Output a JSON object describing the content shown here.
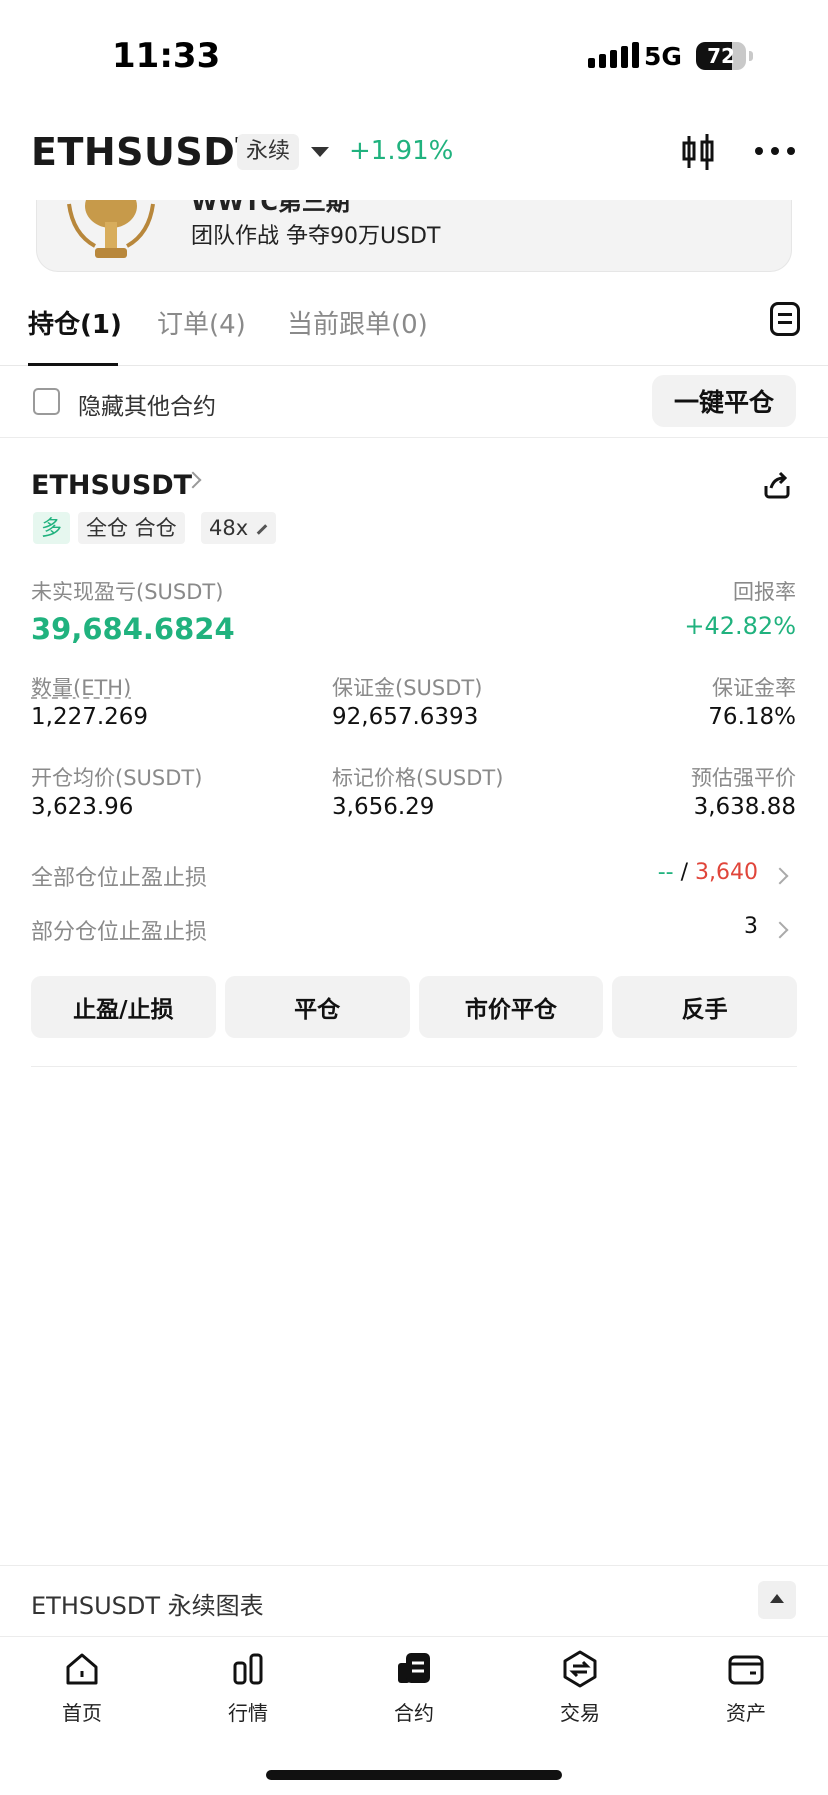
{
  "status_bar": {
    "time": "11:33",
    "network": "5G",
    "battery": "72",
    "battery_level": 0.72
  },
  "header": {
    "symbol": "ETHSUSDT",
    "contract_type": "永续",
    "change": "+1.91%"
  },
  "banner": {
    "title_partial": "WWTC第三期",
    "text": "团队作战 争夺90万USDT"
  },
  "tabs": [
    {
      "label": "持仓(1)",
      "active": true
    },
    {
      "label": "订单(4)",
      "active": false
    },
    {
      "label": "当前跟单(0)",
      "active": false
    }
  ],
  "filter": {
    "hide_label": "隐藏其他合约",
    "close_all": "一键平仓"
  },
  "position": {
    "symbol": "ETHSUSDT",
    "side": "多",
    "margin_mode": "全仓 合仓",
    "leverage": "48x",
    "pnl_label": "未实现盈亏(SUSDT)",
    "pnl_value": "39,684.6824",
    "roe_label": "回报率",
    "roe_value": "+42.82%",
    "qty_label": "数量(ETH)",
    "qty_value": "1,227.269",
    "margin_label": "保证金(SUSDT)",
    "margin_value": "92,657.6393",
    "margin_rate_label": "保证金率",
    "margin_rate_value": "76.18%",
    "entry_label": "开仓均价(SUSDT)",
    "entry_value": "3,623.96",
    "mark_label": "标记价格(SUSDT)",
    "mark_value": "3,656.29",
    "liq_label": "预估强平价",
    "liq_value": "3,638.88",
    "tpsl_all_label": "全部仓位止盈止损",
    "tpsl_all_tp": "--",
    "tpsl_all_sep": "/",
    "tpsl_all_sl": "3,640",
    "tpsl_part_label": "部分仓位止盈止损",
    "tpsl_part_count": "3",
    "buttons": {
      "tpsl": "止盈/止损",
      "close": "平仓",
      "market_close": "市价平仓",
      "reverse": "反手"
    }
  },
  "chart_bar": {
    "title": "ETHSUSDT 永续图表"
  },
  "bottom_nav": [
    {
      "label": "首页",
      "icon": "home-icon"
    },
    {
      "label": "行情",
      "icon": "market-icon"
    },
    {
      "label": "合约",
      "icon": "futures-icon"
    },
    {
      "label": "交易",
      "icon": "trade-icon"
    },
    {
      "label": "资产",
      "icon": "wallet-icon"
    }
  ],
  "colors": {
    "green": "#20b27e",
    "red": "#e0453a"
  }
}
